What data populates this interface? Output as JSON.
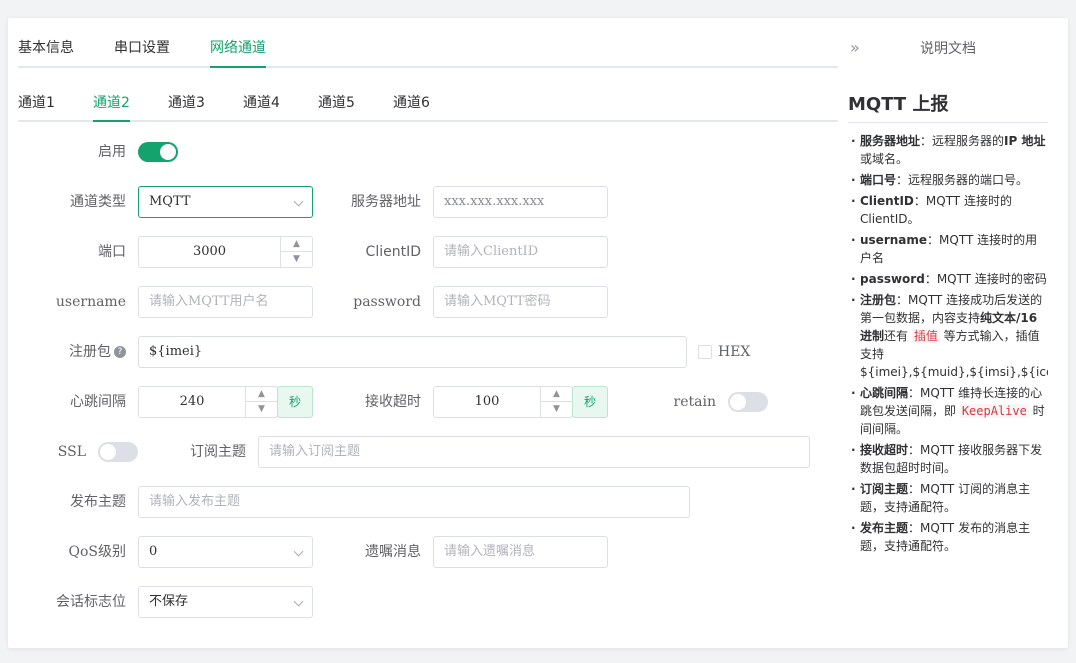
{
  "top_tabs": [
    "基本信息",
    "串口设置",
    "网络通道"
  ],
  "channel_tabs": [
    "通道1",
    "通道2",
    "通道3",
    "通道4",
    "通道5",
    "通道6"
  ],
  "form": {
    "enable_label": "启用",
    "channel_type_label": "通道类型",
    "channel_type_value": "MQTT",
    "server_label": "服务器地址",
    "server_placeholder": "xxx.xxx.xxx.xxx",
    "port_label": "端口",
    "port_value": "3000",
    "clientid_label": "ClientID",
    "clientid_placeholder": "请输入ClientID",
    "username_label": "username",
    "username_placeholder": "请输入MQTT用户名",
    "password_label": "password",
    "password_placeholder": "请输入MQTT密码",
    "register_label": "注册包",
    "register_value": "${imei}",
    "hex_label": "HEX",
    "heartbeat_label": "心跳间隔",
    "heartbeat_value": "240",
    "heartbeat_unit": "秒",
    "timeout_label": "接收超时",
    "timeout_value": "100",
    "timeout_unit": "秒",
    "retain_label": "retain",
    "ssl_label": "SSL",
    "subscribe_label": "订阅主题",
    "subscribe_placeholder": "请输入订阅主题",
    "publish_label": "发布主题",
    "publish_placeholder": "请输入发布主题",
    "qos_label": "QoS级别",
    "qos_value": "0",
    "will_label": "遗嘱消息",
    "will_placeholder": "请输入遗嘱消息",
    "session_label": "会话标志位",
    "session_value": "不保存"
  },
  "doc": {
    "collapse_icon": "»",
    "header": "说明文档",
    "title": "MQTT 上报",
    "items": [
      {
        "key": "服务器地址",
        "pre": "：远程服务器的",
        "bold2": "IP 地址",
        "mid": "",
        "code": "",
        "rest": "或域名。"
      },
      {
        "key": "端口号",
        "pre": "：远程服务器的端口号。",
        "bold2": "",
        "mid": "",
        "code": "",
        "rest": ""
      },
      {
        "key": "ClientID",
        "pre": "：MQTT 连接时的 ClientID。",
        "bold2": "",
        "mid": "",
        "code": "",
        "rest": ""
      },
      {
        "key": "username",
        "pre": "：MQTT 连接时的用户名",
        "bold2": "",
        "mid": "",
        "code": "",
        "rest": ""
      },
      {
        "key": "password",
        "pre": "：MQTT 连接时的密码",
        "bold2": "",
        "mid": "",
        "code": "",
        "rest": ""
      },
      {
        "key": "注册包",
        "pre": "：MQTT 连接成功后发送的第一包数据，内容支持",
        "bold2": "纯文本/16进制",
        "mid": "还有 ",
        "code": "插值",
        "rest": " 等方式输入，插值支持 ${imei},${muid},${imsi},${iccid},${csq}"
      },
      {
        "key": "心跳间隔",
        "pre": "：MQTT 维持长连接的心跳包发送间隔，即 ",
        "bold2": "",
        "mid": "",
        "code": "KeepAlive",
        "rest": " 时间间隔。"
      },
      {
        "key": "接收超时",
        "pre": "：MQTT 接收服务器下发数据包超时时间。",
        "bold2": "",
        "mid": "",
        "code": "",
        "rest": ""
      },
      {
        "key": "订阅主题",
        "pre": "：MQTT 订阅的消息主题，支持通配符。",
        "bold2": "",
        "mid": "",
        "code": "",
        "rest": ""
      },
      {
        "key": "发布主题",
        "pre": "：MQTT 发布的消息主题，支持通配符。",
        "bold2": "",
        "mid": "",
        "code": "",
        "rest": ""
      }
    ]
  },
  "colors": {
    "accent": "#14a36c",
    "border": "#dcdfe6"
  }
}
